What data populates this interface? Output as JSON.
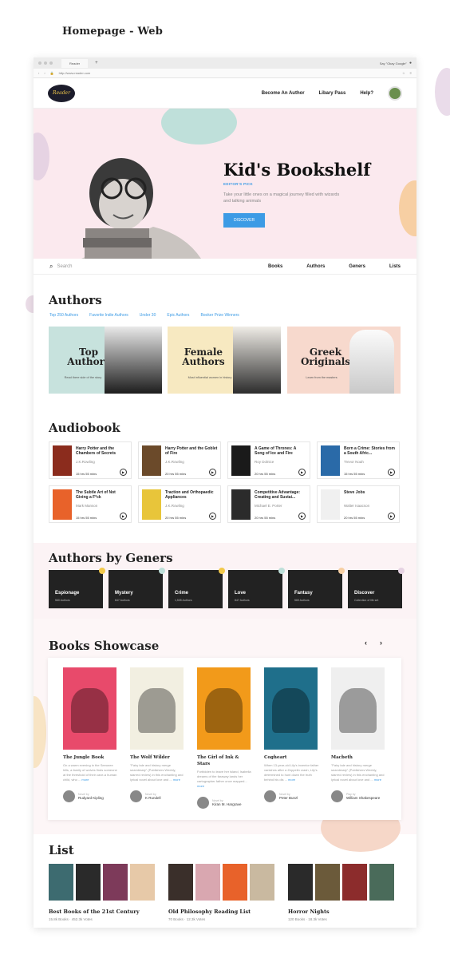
{
  "page_label": "Homepage - Web",
  "browser": {
    "tab": "Reader",
    "url": "http://www.reader.com",
    "voice_hint": "Say \"Okay Google\""
  },
  "nav": {
    "logo": "Reader",
    "items": [
      "Become An Author",
      "Libary Pass",
      "Help?"
    ]
  },
  "hero": {
    "title": "Kid's Bookshelf",
    "pick": "EDITOR'S PICK",
    "sub": "Take your little ones on a magical journey filled with wizards and talking animals",
    "button": "DISCOVER"
  },
  "searchbar": {
    "placeholder": "Search",
    "links": [
      "Books",
      "Authors",
      "Geners",
      "Lists"
    ]
  },
  "authors": {
    "title": "Authors",
    "filters": [
      "Top 250 Authors",
      "Favorite Indie Authors",
      "Under 30",
      "Epic Authors",
      "Booker Prize Winners"
    ],
    "cards": [
      {
        "title": "Top Authors",
        "sub": "Read there side of the story",
        "bg": "#c7e2dd"
      },
      {
        "title": "Female Authors",
        "sub": "Most influential women in history",
        "bg": "#f7e9c1"
      },
      {
        "title": "Greek Originals",
        "sub": "Learn from the masters",
        "bg": "#f7d9cd"
      }
    ]
  },
  "audiobook": {
    "title": "Audiobook",
    "items": [
      {
        "title": "Harry Potter and the Chambers of Secrets",
        "author": "J.K.Rowling",
        "duration": "15 hrs 55 mins",
        "color": "#8b2c1d"
      },
      {
        "title": "Harry Potter and the Goblet of Fire",
        "author": "J.K.Rowling",
        "duration": "20 hrs 55 mins",
        "color": "#6b4a2a"
      },
      {
        "title": "A Game of Thrones: A Song of Ice and Fire",
        "author": "Roy Dolnice",
        "duration": "20 hrs 55 mins",
        "color": "#1a1a1a"
      },
      {
        "title": "Born a Crime: Stories from a South Afric...",
        "author": "Trevor Noah",
        "duration": "15 hrs 55 mins",
        "color": "#2a6aa8"
      },
      {
        "title": "The Subtle Art of Not Giving a F*ck",
        "author": "Mark Manson",
        "duration": "15 hrs 55 mins",
        "color": "#e8622a"
      },
      {
        "title": "Traction and Orthopaedic Appliances",
        "author": "J.K.Rowling",
        "duration": "20 hrs 55 mins",
        "color": "#e8c53a"
      },
      {
        "title": "Competitive Advantage: Creating and Sustai...",
        "author": "Michael E. Porter",
        "duration": "20 hrs 55 mins",
        "color": "#2b2b2b"
      },
      {
        "title": "Steve Jobs",
        "author": "Walter Isaacson",
        "duration": "20 hrs 55 mins",
        "color": "#f0f0f0"
      }
    ]
  },
  "geners": {
    "title": "Authors by Geners",
    "items": [
      {
        "name": "Espionage",
        "count": "560 Authors"
      },
      {
        "name": "Mystery",
        "count": "847 Authors"
      },
      {
        "name": "Crime",
        "count": "1,505 Authors"
      },
      {
        "name": "Love",
        "count": "847 Authors"
      },
      {
        "name": "Fantasy",
        "count": "569 Authors"
      },
      {
        "name": "Discover",
        "count": "Collection of life set"
      }
    ]
  },
  "showcase": {
    "title": "Books Showcase",
    "items": [
      {
        "title": "The Jungle Book",
        "desc": "On a warm evening in the Seeonee hills, a family of wolves finds someone at the threshold of their cave-a human child, who ...",
        "author": "Rudyard Kipling",
        "role": "Novel by",
        "color": "#e84a6b"
      },
      {
        "title": "The Wolf Wilder",
        "desc": "\"Fairy tale and history merge seamlessly\" (Publishers Weekly, starred review) in this enchanting and lyrical novel about love and ...",
        "author": "K Rundell",
        "role": "Novel by",
        "color": "#f2efe1"
      },
      {
        "title": "The Girl of Ink & Stars",
        "desc": "Forbidden to leave her island, Isabella dreams of the faraway lands her cartographer father once mapped...",
        "author": "Kiran M. Hargrave",
        "role": "Novel by",
        "color": "#f29a1a"
      },
      {
        "title": "Cogheart",
        "desc": "When 13-year-old Lily's inventor father vanishes after a Zeppelin crash, Lily's determined to hunt down the truth behind his dis ...",
        "author": "Peter Bunzl",
        "role": "Novel by",
        "color": "#1f6f8b"
      },
      {
        "title": "Macbeth",
        "desc": "\"Fairy tale and history merge seamlessly\" (Publishers Weekly, starred review) in this enchanting and lyrical novel about love and ...",
        "author": "William Shakespeare",
        "role": "Play by",
        "color": "#efefef"
      }
    ]
  },
  "more": "more",
  "list": {
    "title": "List",
    "groups": [
      {
        "title": "Best Books of the 21st Century",
        "meta": "15.8k Books  ·  452.3k Votes"
      },
      {
        "title": "Old Philosophy Reading List",
        "meta": "70 Books  ·  12.3k Votes"
      },
      {
        "title": "Horror Nights",
        "meta": "120 Books  ·  18.3k Votes"
      }
    ]
  }
}
